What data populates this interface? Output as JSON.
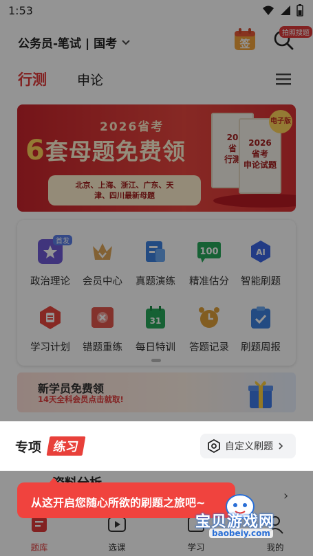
{
  "status_bar": {
    "time": "1:53"
  },
  "header": {
    "exam_selector": "公务员-笔试 | 国考",
    "sign_label": "签",
    "photo_search_badge": "拍照搜题"
  },
  "tabs": [
    {
      "label": "行测",
      "active": true
    },
    {
      "label": "申论",
      "active": false
    }
  ],
  "banner": {
    "year_text": "2026省考",
    "headline_number": "6",
    "headline_rest": "套母题免费领",
    "cities_line1": "北京、上海、浙江、广东、天",
    "cities_line2": "津、四川最新母题",
    "book1": "20\n省\n行测",
    "book2": "2026\n省考\n申论试题",
    "edition_badge": "电子版"
  },
  "feature_grid": {
    "items": [
      {
        "label": "政治理论",
        "icon": "star-card-icon",
        "color": "#6f5bd6",
        "badge": "首发"
      },
      {
        "label": "会员中心",
        "icon": "crown-icon",
        "color": "#e0a85a"
      },
      {
        "label": "真题演练",
        "icon": "document-icon",
        "color": "#3d82e0"
      },
      {
        "label": "精准估分",
        "icon": "score-100-icon",
        "color": "#27a85a",
        "text": "100"
      },
      {
        "label": "智能刷题",
        "icon": "ai-icon",
        "color": "#3b66e6",
        "text": "AI"
      },
      {
        "label": "学习计划",
        "icon": "plan-icon",
        "color": "#e8483f"
      },
      {
        "label": "错题重练",
        "icon": "wrong-question-icon",
        "color": "#e2574c"
      },
      {
        "label": "每日特训",
        "icon": "calendar-icon",
        "color": "#27a85a",
        "text": "31"
      },
      {
        "label": "答题记录",
        "icon": "alarm-clock-icon",
        "color": "#e0a13a"
      },
      {
        "label": "刷题周报",
        "icon": "clipboard-check-icon",
        "color": "#3d82e0"
      }
    ]
  },
  "promo": {
    "title": "新学员免费领",
    "subtitle": "14天全科会员点击就取!"
  },
  "practice": {
    "label_a": "专项",
    "label_b": "练习",
    "custom_button": "自定义刷题"
  },
  "section_partial_title": "资料分析",
  "tooltip": {
    "text": "从这开启您随心所欲的刷题之旅吧~"
  },
  "bottom_nav": [
    {
      "label": "题库",
      "icon": "question-bank-icon",
      "active": true
    },
    {
      "label": "选课",
      "icon": "course-play-icon",
      "active": false
    },
    {
      "label": "学习",
      "icon": "study-icon",
      "active": false
    },
    {
      "label": "我的",
      "icon": "profile-icon",
      "active": false
    }
  ],
  "watermark": {
    "title": "宝贝游戏网",
    "url": "baobeiy.com"
  },
  "colors": {
    "accent": "#e03a3a",
    "tooltip": "#f0433e"
  }
}
